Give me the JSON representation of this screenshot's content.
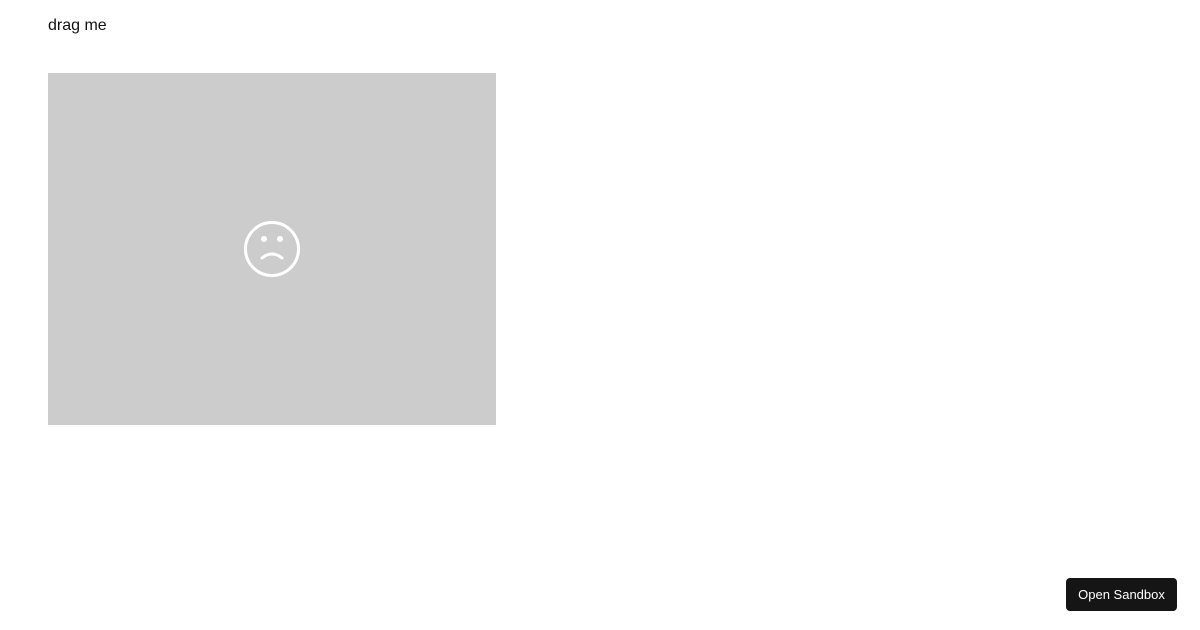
{
  "drag_label": "drag me",
  "image_placeholder": {
    "icon": "sad-face-icon",
    "background_color": "#cccccc",
    "icon_color": "#ffffff"
  },
  "open_sandbox_button": {
    "label": "Open Sandbox",
    "background_color": "#151515"
  }
}
